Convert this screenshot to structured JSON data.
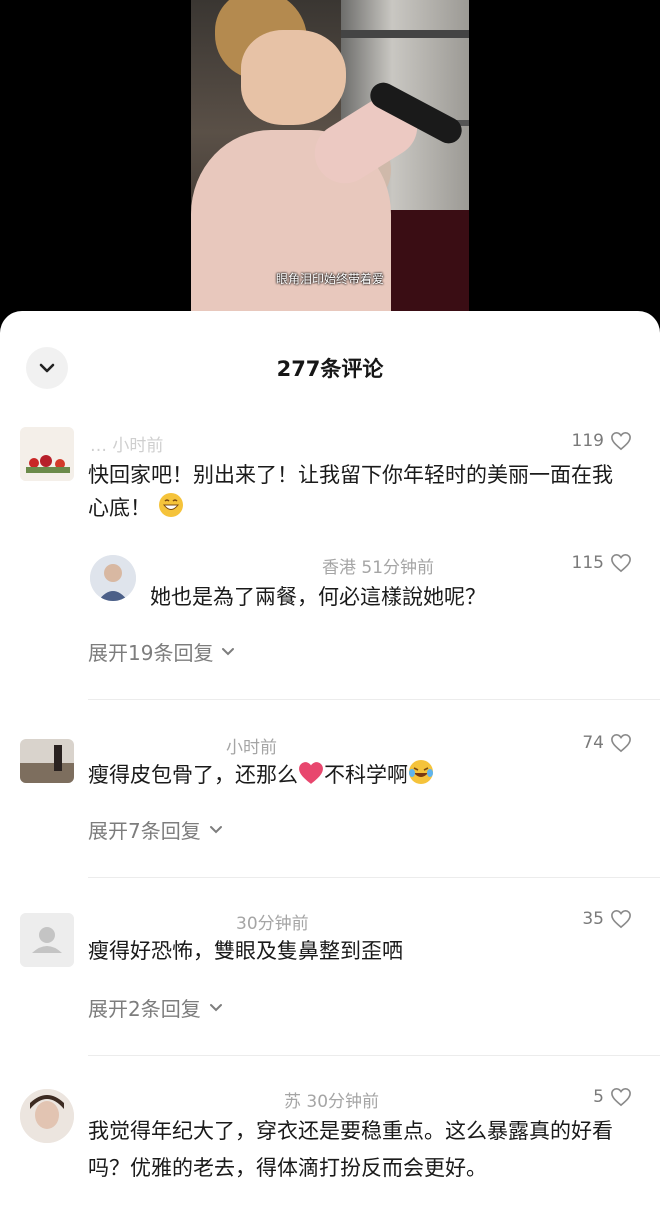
{
  "video": {
    "subtitle": "眼角泪印始终带着爱"
  },
  "sheet": {
    "title": "277条评论"
  },
  "comments": [
    {
      "meta": "… 小时前",
      "likes": "119",
      "text": "快回家吧！别出来了！让我留下你年轻时的美丽一面在我心底！",
      "emoji": "grinning-face-icon"
    },
    {
      "meta": "香港 51分钟前",
      "likes": "115",
      "text": "她也是為了兩餐，何必這樣說她呢？"
    },
    {
      "meta": "小时前",
      "likes": "74",
      "text_a": "瘦得皮包骨了，还那么",
      "text_b": "不科学啊"
    },
    {
      "meta": "30分钟前",
      "likes": "35",
      "text": "瘦得好恐怖，雙眼及隻鼻整到歪哂"
    },
    {
      "meta": "苏 30分钟前",
      "likes": "5",
      "text": "我觉得年纪大了，穿衣还是要稳重点。这么暴露真的好看吗？优雅的老去，得体滴打扮反而会更好。"
    }
  ],
  "expand": [
    {
      "label": "展开19条回复"
    },
    {
      "label": "展开7条回复"
    },
    {
      "label": "展开2条回复"
    }
  ],
  "colors": {
    "heart_emoji": "#e8476e",
    "laugh_emoji": "#f5c33b"
  }
}
